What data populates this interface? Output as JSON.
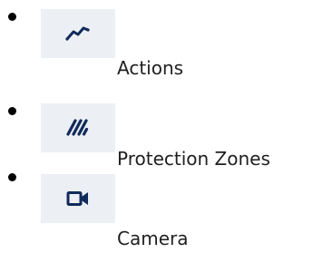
{
  "menu": {
    "items": [
      {
        "label": "Actions",
        "icon": "activity-line-icon"
      },
      {
        "label": "Protection Zones",
        "icon": "hatched-zone-icon"
      },
      {
        "label": "Camera",
        "icon": "video-camera-icon"
      }
    ]
  },
  "colors": {
    "icon": "#102a5a",
    "tile_background": "#eceff4",
    "bullet": "#000000",
    "text": "#1f1f1f"
  }
}
